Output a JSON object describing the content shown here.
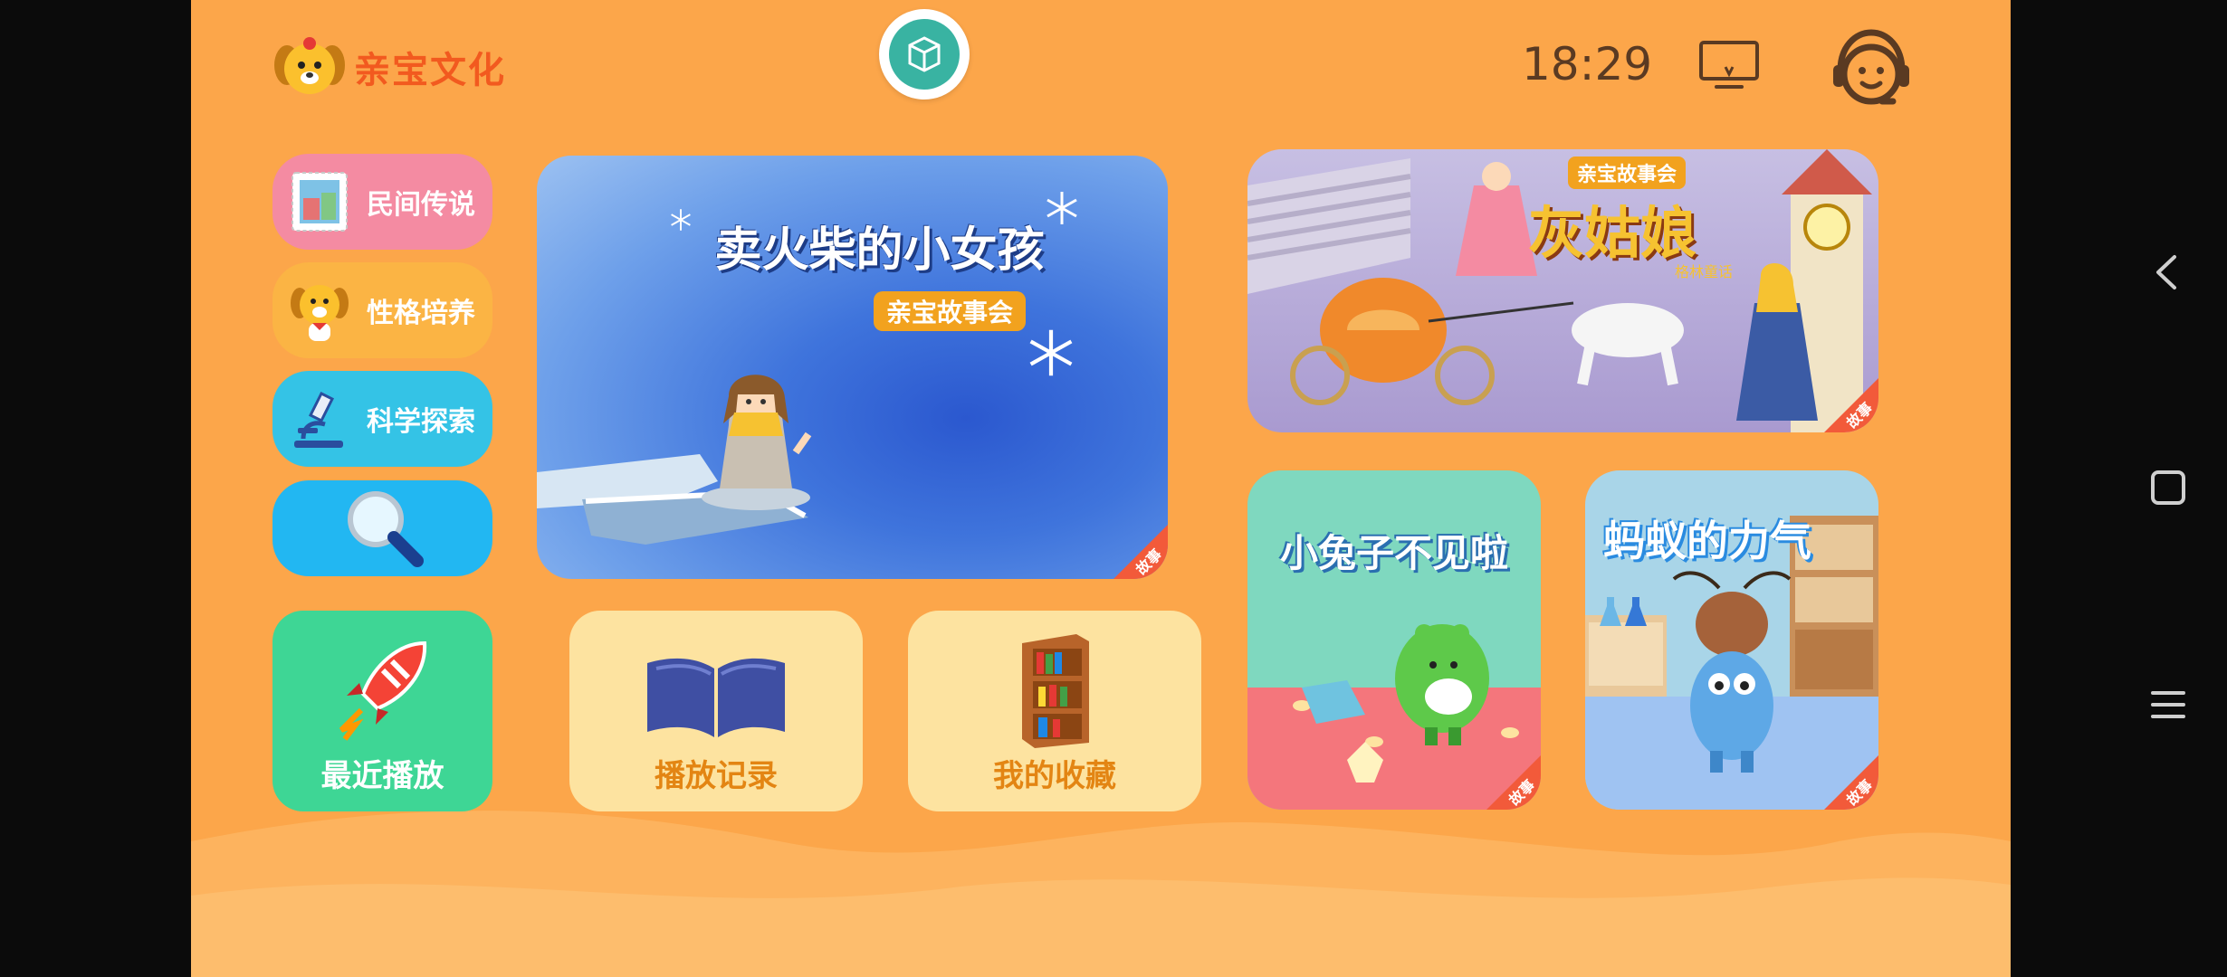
{
  "brand": {
    "name": "亲宝文化"
  },
  "status": {
    "time": "18:29"
  },
  "header_icons": {
    "center": "cube-icon",
    "tv": "tv-icon",
    "service": "customer-service-icon"
  },
  "sidebar": [
    {
      "label": "民间传说",
      "icon": "stamp-icon"
    },
    {
      "label": "性格培养",
      "icon": "puppy-icon"
    },
    {
      "label": "科学探索",
      "icon": "microscope-icon"
    },
    {
      "label": "",
      "icon": "search-icon"
    }
  ],
  "recent": {
    "label": "最近播放",
    "icon": "rocket-icon"
  },
  "play_log": {
    "label": "播放记录",
    "icon": "book-icon"
  },
  "favorites": {
    "label": "我的收藏",
    "icon": "bookshelf-icon"
  },
  "cards": {
    "match": {
      "title": "卖火柴的小女孩",
      "sub": "亲宝故事会",
      "tag": "故事"
    },
    "cinder": {
      "title": "灰姑娘",
      "sub": "亲宝故事会",
      "small": "格林童话",
      "tag": "故事"
    },
    "rabbit": {
      "title": "小兔子不见啦",
      "tag": "故事"
    },
    "ant": {
      "title": "蚂蚁的力气",
      "tag": "故事"
    }
  },
  "colors": {
    "background": "#fca64a",
    "pink": "#f48ba2",
    "yellow": "#fbb444",
    "cyan": "#34c3e6",
    "blue": "#22b7f2",
    "green": "#3ed695",
    "cream": "#fde3a0",
    "tag_red": "#f25a3a"
  },
  "system_nav": {
    "back": "back-icon",
    "home": "home-icon",
    "menu": "menu-icon"
  }
}
